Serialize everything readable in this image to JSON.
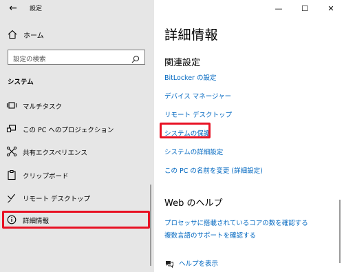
{
  "window": {
    "title": "設定",
    "back_glyph": "←",
    "controls": {
      "minimize": "—",
      "maximize": "☐",
      "close": "✕"
    }
  },
  "sidebar": {
    "home_label": "ホーム",
    "search_placeholder": "設定の検索",
    "section_title": "システム",
    "items": [
      {
        "label": "マルチタスク",
        "icon": "multitask-icon"
      },
      {
        "label": "この PC へのプロジェクション",
        "icon": "projection-icon"
      },
      {
        "label": "共有エクスペリエンス",
        "icon": "shared-experience-icon"
      },
      {
        "label": "クリップボード",
        "icon": "clipboard-icon"
      },
      {
        "label": "リモート デスクトップ",
        "icon": "remote-desktop-icon"
      },
      {
        "label": "詳細情報",
        "icon": "info-icon",
        "selected": true
      }
    ]
  },
  "main": {
    "title": "詳細情報",
    "related_title": "関連設定",
    "related_links": [
      "BitLocker の設定",
      "デバイス マネージャー",
      "リモート デスクトップ",
      "システムの保護",
      "システムの詳細設定",
      "この PC の名前を変更 (詳細設定)"
    ],
    "web_help_title": "Web のヘルプ",
    "web_links": [
      "プロセッサに搭載されているコアの数を確認する",
      "複数言語のサポートを確認する"
    ],
    "help_link": "ヘルプを表示"
  },
  "colors": {
    "sidebar_bg": "#e6e6e6",
    "link": "#0067c0",
    "highlight": "#e81123"
  }
}
